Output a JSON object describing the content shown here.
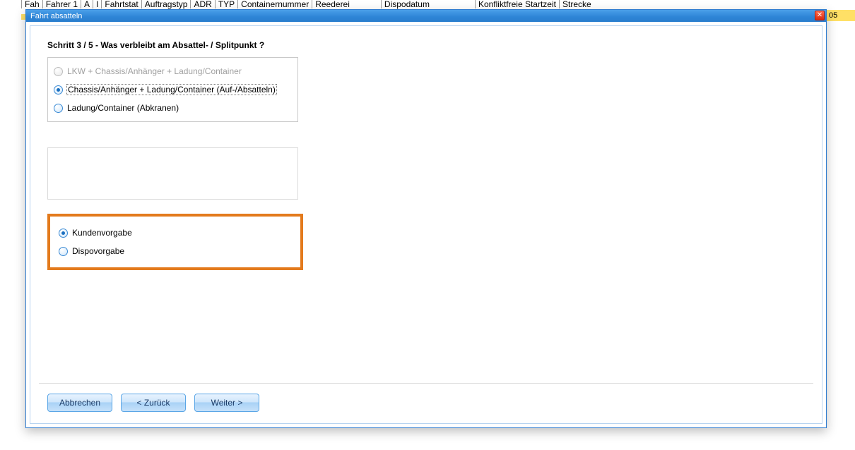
{
  "background": {
    "columns": [
      "Fah",
      "Fahrer 1",
      "A",
      "I",
      "Fahrtstat",
      "Auftragstyp",
      "ADR",
      "TYP",
      "Containernummer",
      "Reederei",
      "Dispodatum",
      "Konfliktfreie Startzeit",
      "Strecke"
    ],
    "rightSnippet": "05"
  },
  "dialog": {
    "title": "Fahrt absatteln",
    "stepTitle": "Schritt 3 / 5 - Was verbleibt am Absattel- / Splitpunkt ?",
    "group1": {
      "options": [
        {
          "label": "LKW + Chassis/Anhänger + Ladung/Container",
          "disabled": true,
          "selected": false
        },
        {
          "label": "Chassis/Anhänger + Ladung/Container (Auf-/Absatteln)",
          "disabled": false,
          "selected": true,
          "focused": true
        },
        {
          "label": "Ladung/Container (Abkranen)",
          "disabled": false,
          "selected": false
        }
      ]
    },
    "group2": {
      "options": [
        {
          "label": "Kundenvorgabe",
          "selected": true
        },
        {
          "label": "Dispovorgabe",
          "selected": false
        }
      ]
    },
    "buttons": {
      "cancel": "Abbrechen",
      "back": "< Zurück",
      "next": "Weiter >"
    }
  }
}
